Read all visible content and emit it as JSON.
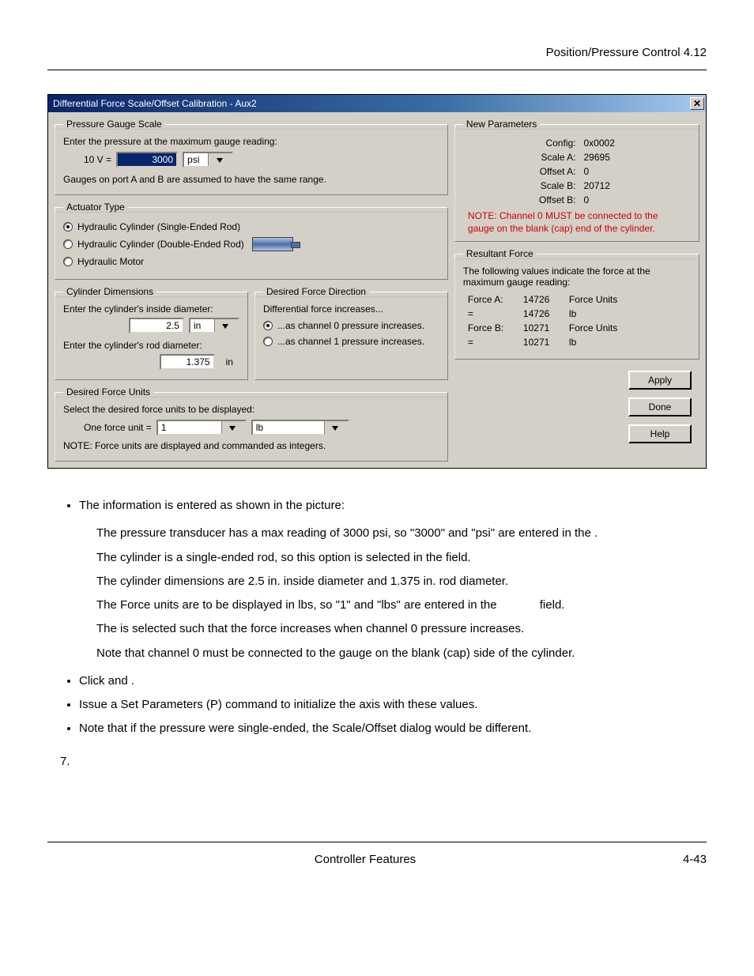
{
  "header": {
    "section_title": "Position/Pressure Control  4.12"
  },
  "footer": {
    "title": "Controller Features",
    "page_no": "4-43"
  },
  "dialog": {
    "title": "Differential Force Scale/Offset Calibration - Aux2",
    "pressure_gauge": {
      "legend": "Pressure Gauge Scale",
      "prompt": "Enter the pressure at the maximum gauge reading:",
      "voltage_label": "10 V   =",
      "value": "3000",
      "unit": "psi",
      "note": "Gauges on port A and B are assumed to have the same range."
    },
    "actuator": {
      "legend": "Actuator Type",
      "opt1": "Hydraulic Cylinder (Single-Ended Rod)",
      "opt2": "Hydraulic Cylinder (Double-Ended Rod)",
      "opt3": "Hydraulic Motor"
    },
    "dimensions": {
      "legend": "Cylinder Dimensions",
      "inside_label": "Enter the cylinder's inside diameter:",
      "inside_val": "2.5",
      "inside_unit": "in",
      "rod_label": "Enter the cylinder's rod diameter:",
      "rod_val": "1.375",
      "rod_unit": "in"
    },
    "direction": {
      "legend": "Desired Force Direction",
      "lead": "Differential force increases...",
      "opt1": "...as channel 0 pressure increases.",
      "opt2": "...as channel 1 pressure increases."
    },
    "force_units": {
      "legend": "Desired Force Units",
      "prompt": "Select the desired force units to be displayed:",
      "one_unit": "One force unit =",
      "value": "1",
      "unit": "lb",
      "note": "NOTE: Force units are displayed and commanded as integers."
    },
    "new_params": {
      "legend": "New Parameters",
      "rows": {
        "config_k": "Config:",
        "config_v": "0x0002",
        "scaleA_k": "Scale A:",
        "scaleA_v": "29695",
        "offsetA_k": "Offset A:",
        "offsetA_v": "0",
        "scaleB_k": "Scale B:",
        "scaleB_v": "20712",
        "offsetB_k": "Offset B:",
        "offsetB_v": "0"
      },
      "note": "NOTE: Channel 0 MUST be connected to the gauge on the blank (cap) end of the cylinder."
    },
    "resultant": {
      "legend": "Resultant Force",
      "lead": "The following values indicate the force at the maximum gauge reading:",
      "fa_k": "Force A:",
      "fa_v": "14726",
      "fa_u": "Force Units",
      "fa_eq": "=",
      "fa_lb": "14726",
      "fa_lbu": "lb",
      "fb_k": "Force B:",
      "fb_v": "10271",
      "fb_u": "Force Units",
      "fb_eq": "=",
      "fb_lb": "10271",
      "fb_lbu": "lb"
    },
    "buttons": {
      "apply": "Apply",
      "done": "Done",
      "help": "Help"
    }
  },
  "doc": {
    "b1": "The information is entered as shown in the picture:",
    "s1": "The pressure transducer has a max reading of 3000 psi, so \"3000\" and \"psi\" are entered in the                                         .",
    "s2": "The cylinder is a single-ended rod, so this option is selected in the                              field.",
    "s3": "The cylinder dimensions are 2.5 in. inside diameter and 1.375 in. rod diameter.",
    "s4": "The Force units are to be displayed in lbs, so \"1\" and \"lbs\" are entered in the             field.",
    "s5": "The                                              is selected such that the force increases when channel 0 pressure increases.",
    "s6": "Note that channel 0 must be connected to the gauge on the blank (cap) side of the cylinder.",
    "b2": "Click               and           .",
    "b3": "Issue a Set Parameters (P) command to initialize the axis with these values.",
    "b4": "Note that if the pressure were single-ended, the Scale/Offset dialog would be different.",
    "step7": "7."
  }
}
